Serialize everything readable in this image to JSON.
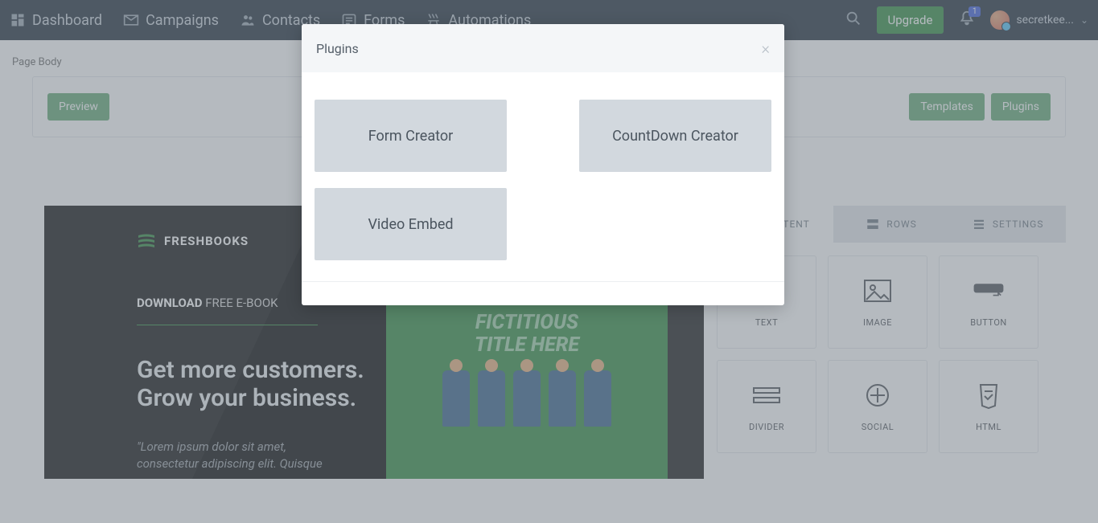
{
  "nav": {
    "dashboard": "Dashboard",
    "campaigns": "Campaigns",
    "contacts": "Contacts",
    "forms": "Forms",
    "automations": "Automations",
    "upgrade": "Upgrade",
    "badge": "1",
    "username": "secretkee..."
  },
  "subhead": "Page Body",
  "toolbar": {
    "preview": "Preview",
    "templates": "Templates",
    "plugins": "Plugins"
  },
  "preview": {
    "brand": "FRESHBOOKS",
    "download_bold": "DOWNLOAD",
    "download_rest": " FREE E-BOOK",
    "headline1": "Get more customers.",
    "headline2": "Grow your business.",
    "lorem": "\"Lorem ipsum dolor sit amet, consectetur adipiscing elit. Quisque",
    "fict1": "FICTITIOUS",
    "fict2": "TITLE HERE"
  },
  "tabs": {
    "content": "CONTENT",
    "rows": "ROWS",
    "settings": "SETTINGS"
  },
  "blocks": {
    "text": "TEXT",
    "image": "IMAGE",
    "button": "BUTTON",
    "divider": "DIVIDER",
    "social": "SOCIAL",
    "html": "HTML"
  },
  "modal": {
    "title": "Plugins",
    "form_creator": "Form Creator",
    "countdown_creator": "CountDown Creator",
    "video_embed": "Video Embed"
  }
}
